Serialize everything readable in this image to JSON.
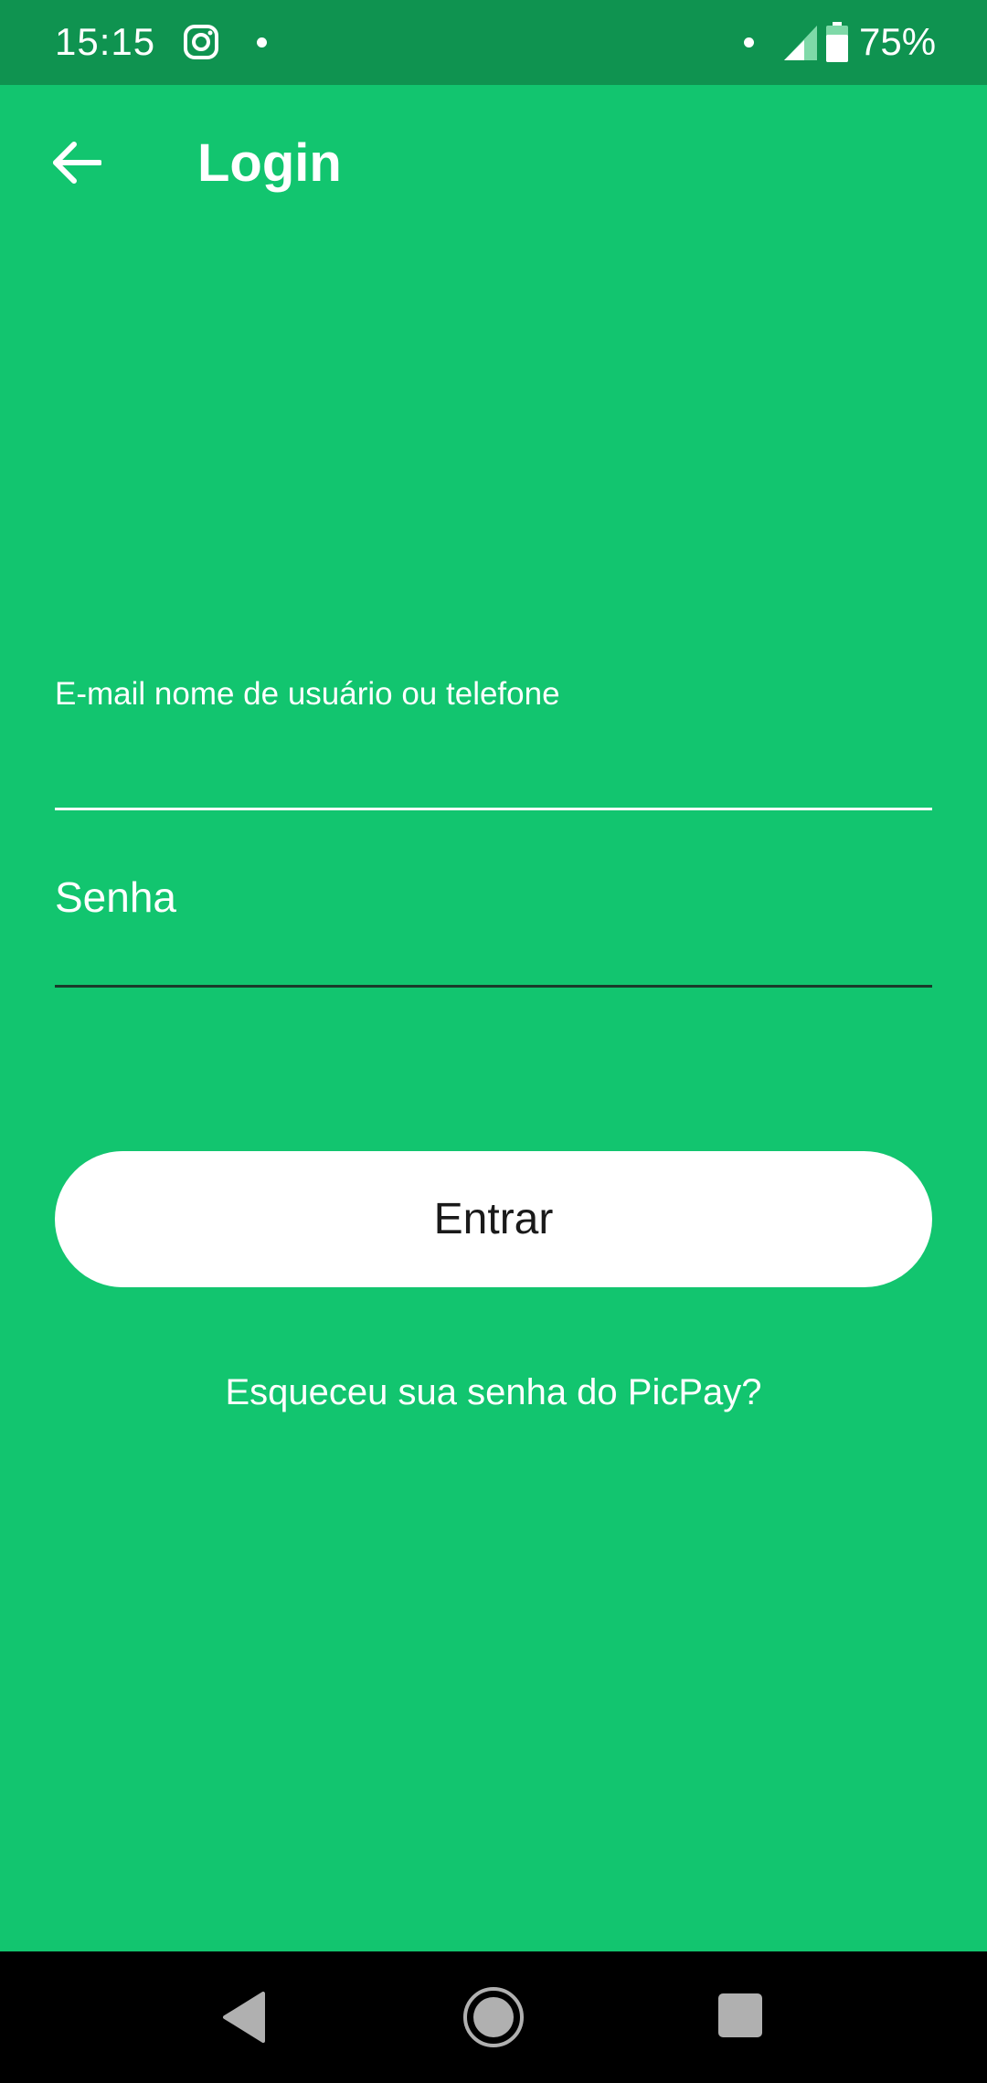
{
  "status_bar": {
    "time": "15:15",
    "battery_percent": "75%",
    "icons": [
      "instagram-icon",
      "notification-dot-icon",
      "notification-dot-icon",
      "cell-signal-icon",
      "battery-icon"
    ]
  },
  "app_bar": {
    "title": "Login",
    "back_icon": "arrow-left-icon"
  },
  "form": {
    "email_label": "E-mail nome de usuário ou telefone",
    "email_value": "",
    "password_label": "Senha",
    "password_value": ""
  },
  "actions": {
    "enter_label": "Entrar",
    "forgot_label": "Esqueceu sua senha do PicPay?"
  },
  "nav_bar": {
    "icons": [
      "nav-back-icon",
      "nav-home-icon",
      "nav-recents-icon"
    ]
  },
  "colors": {
    "background": "#12c56f",
    "status_bar": "#0f9350",
    "button": "#ffffff",
    "button_text": "#1a1a1a"
  }
}
